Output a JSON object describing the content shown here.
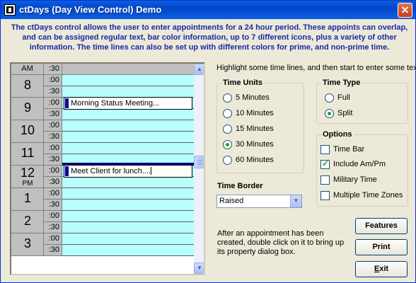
{
  "window": {
    "title": "ctDays (Day View Control) Demo",
    "close_label": "✕"
  },
  "intro": "The ctDays control allows the user to enter appointments for a 24 hour period. These appoints can overlap, and can be assigned regular text, bar color information, up to 7 different icons, plus a variety of other information. The time lines can also be set up with different colors for prime, and non-prime time.",
  "dayview": {
    "header_hour": "AM",
    "header_min": ":30",
    "hours": [
      {
        "hour": "8",
        "ampm": "",
        "m1": ":00",
        "m2": ":30"
      },
      {
        "hour": "9",
        "ampm": "",
        "m1": ":00",
        "m2": ":30"
      },
      {
        "hour": "10",
        "ampm": "",
        "m1": ":00",
        "m2": ":30"
      },
      {
        "hour": "11",
        "ampm": "",
        "m1": ":00",
        "m2": ":30"
      },
      {
        "hour": "12",
        "ampm": "PM",
        "m1": ":00",
        "m2": ":30"
      },
      {
        "hour": "1",
        "ampm": "",
        "m1": ":00",
        "m2": ":30"
      },
      {
        "hour": "2",
        "ampm": "",
        "m1": ":00",
        "m2": ":30"
      },
      {
        "hour": "3",
        "ampm": "",
        "m1": ":00",
        "m2": ":30"
      }
    ],
    "appointments": [
      {
        "text": "Morning Status Meeting..."
      },
      {
        "text": "Meet Client for lunch...."
      }
    ]
  },
  "hint": "Highlight some time lines, and then start to enter some text.",
  "time_units": {
    "legend": "Time Units",
    "options": [
      "5 Minutes",
      "10 Minutes",
      "15 Minutes",
      "30 Minutes",
      "60 Minutes"
    ],
    "selected": "30 Minutes"
  },
  "time_type": {
    "legend": "Time Type",
    "options": [
      "Full",
      "Split"
    ],
    "selected": "Split"
  },
  "options": {
    "legend": "Options",
    "items": [
      {
        "label": "Time Bar",
        "checked": false
      },
      {
        "label": "Include Am/Pm",
        "checked": true
      },
      {
        "label": "Military Time",
        "checked": false
      },
      {
        "label": "Multiple Time Zones",
        "checked": false
      }
    ]
  },
  "time_border": {
    "label": "Time Border",
    "value": "Raised"
  },
  "note": "After an appointment has been created, double click on it to bring up its property dialog box.",
  "buttons": {
    "features": "Features",
    "print": "Print",
    "exit_u": "E",
    "exit_rest": "xit"
  }
}
